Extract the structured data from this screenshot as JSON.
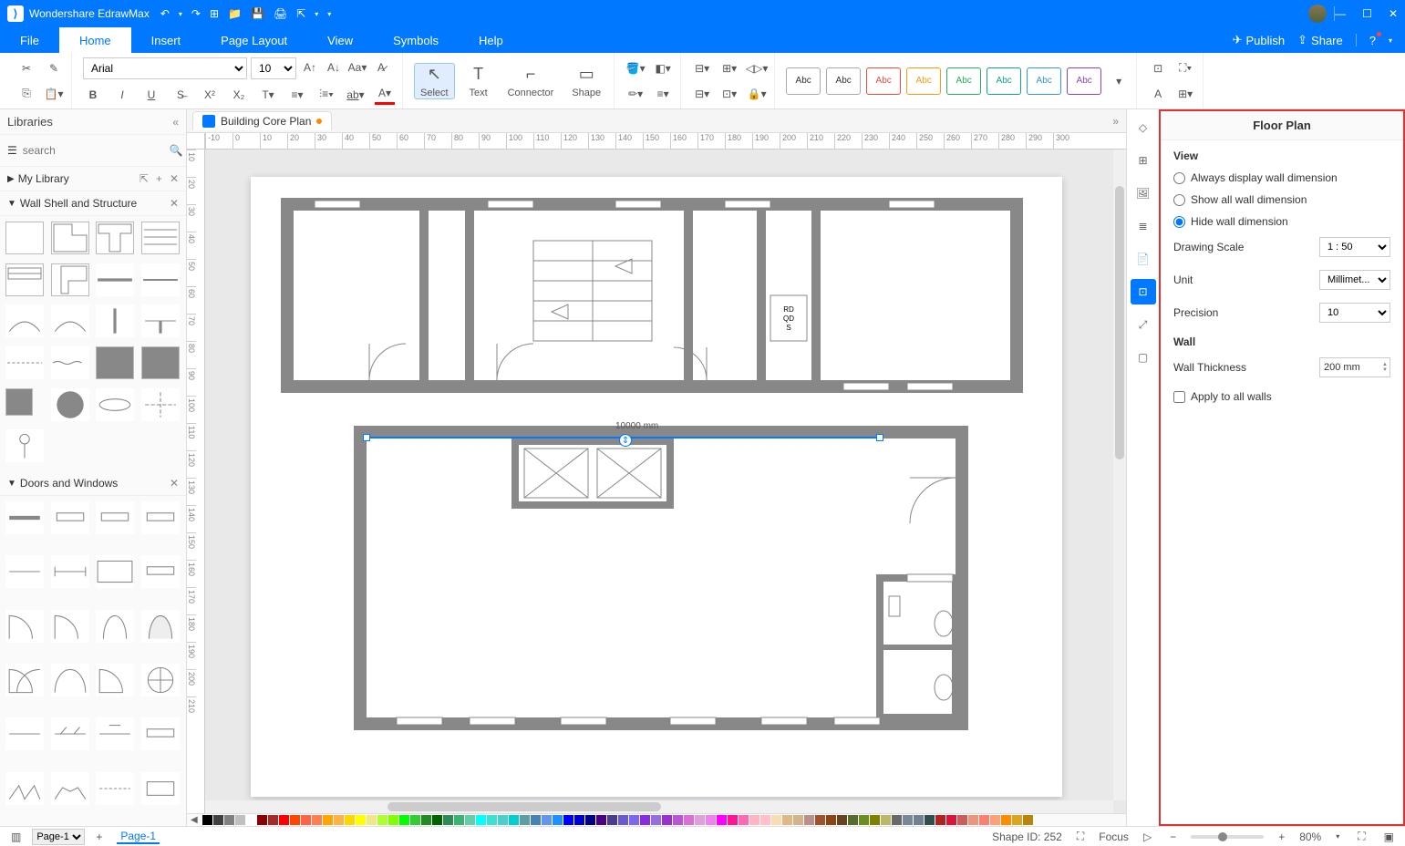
{
  "app": {
    "title": "Wondershare EdrawMax"
  },
  "menu": {
    "items": [
      "File",
      "Home",
      "Insert",
      "Page Layout",
      "View",
      "Symbols",
      "Help"
    ],
    "active": "Home",
    "publish": "Publish",
    "share": "Share"
  },
  "ribbon": {
    "font": "Arial",
    "size": "10",
    "tools": {
      "select": "Select",
      "text": "Text",
      "connector": "Connector",
      "shape": "Shape"
    },
    "style_label": "Abc"
  },
  "left": {
    "title": "Libraries",
    "search_placeholder": "search",
    "mylib": "My Library",
    "sections": [
      "Wall Shell and Structure",
      "Doors and Windows"
    ]
  },
  "doc": {
    "tab": "Building Core Plan"
  },
  "ruler_h": [
    "-10",
    "0",
    "10",
    "20",
    "30",
    "40",
    "50",
    "60",
    "70",
    "80",
    "90",
    "100",
    "110",
    "120",
    "130",
    "140",
    "150",
    "160",
    "170",
    "180",
    "190",
    "200",
    "210",
    "220",
    "230",
    "240",
    "250",
    "260",
    "270",
    "280",
    "290",
    "300"
  ],
  "ruler_v": [
    "10",
    "20",
    "30",
    "40",
    "50",
    "60",
    "70",
    "80",
    "90",
    "100",
    "110",
    "120",
    "130",
    "140",
    "150",
    "160",
    "170",
    "180",
    "190",
    "200",
    "210"
  ],
  "canvas": {
    "dimension_label": "10000 mm",
    "closet_label": "RD\nQD\nS"
  },
  "rightpanel": {
    "title": "Floor Plan",
    "view": {
      "title": "View",
      "opt1": "Always display wall dimension",
      "opt2": "Show all wall dimension",
      "opt3": "Hide wall dimension"
    },
    "scale": {
      "label": "Drawing Scale",
      "value": "1 : 50"
    },
    "unit": {
      "label": "Unit",
      "value": "Millimet..."
    },
    "precision": {
      "label": "Precision",
      "value": "10"
    },
    "wall": {
      "title": "Wall",
      "thickness_label": "Wall Thickness",
      "thickness_value": "200 mm",
      "apply": "Apply to all walls"
    }
  },
  "status": {
    "page_tab": "Page-1",
    "page_current": "Page-1",
    "shape_id": "Shape ID: 252",
    "focus": "Focus",
    "zoom": "80%"
  },
  "colors": [
    "#000000",
    "#404040",
    "#808080",
    "#c0c0c0",
    "#ffffff",
    "#8b0000",
    "#a52a2a",
    "#ff0000",
    "#ff4500",
    "#ff6347",
    "#ff7f50",
    "#ffa500",
    "#ffb347",
    "#ffd700",
    "#ffff00",
    "#f0e68c",
    "#adff2f",
    "#7fff00",
    "#00ff00",
    "#32cd32",
    "#228b22",
    "#006400",
    "#2e8b57",
    "#3cb371",
    "#66cdaa",
    "#00ffff",
    "#40e0d0",
    "#48d1cc",
    "#00ced1",
    "#5f9ea0",
    "#4682b4",
    "#6495ed",
    "#1e90ff",
    "#0000ff",
    "#0000cd",
    "#00008b",
    "#4b0082",
    "#483d8b",
    "#6a5acd",
    "#7b68ee",
    "#8a2be2",
    "#9370db",
    "#9932cc",
    "#ba55d3",
    "#da70d6",
    "#dda0dd",
    "#ee82ee",
    "#ff00ff",
    "#ff1493",
    "#ff69b4",
    "#ffb6c1",
    "#ffc0cb",
    "#f5deb3",
    "#deb887",
    "#d2b48c",
    "#bc8f8f",
    "#a0522d",
    "#8b4513",
    "#654321",
    "#556b2f",
    "#6b8e23",
    "#808000",
    "#bdb76b",
    "#696969",
    "#778899",
    "#708090",
    "#2f4f4f",
    "#b22222",
    "#dc143c",
    "#cd5c5c",
    "#e9967a",
    "#fa8072",
    "#ffa07a",
    "#ff8c00",
    "#daa520",
    "#b8860b"
  ]
}
